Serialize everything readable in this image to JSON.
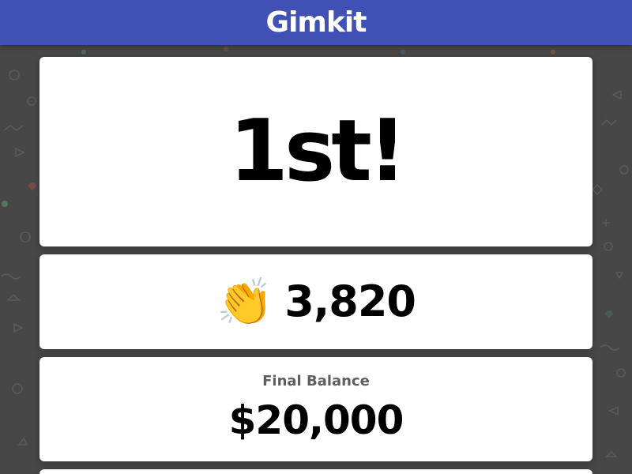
{
  "header": {
    "logo_text": "Gimkit",
    "bar_color": "#4150b4"
  },
  "placement": {
    "text": "1st!"
  },
  "score": {
    "icon": "clapping-hands-icon",
    "icon_glyph": "👏",
    "value": "3,820"
  },
  "balance": {
    "label": "Final Balance",
    "value": "$20,000"
  }
}
